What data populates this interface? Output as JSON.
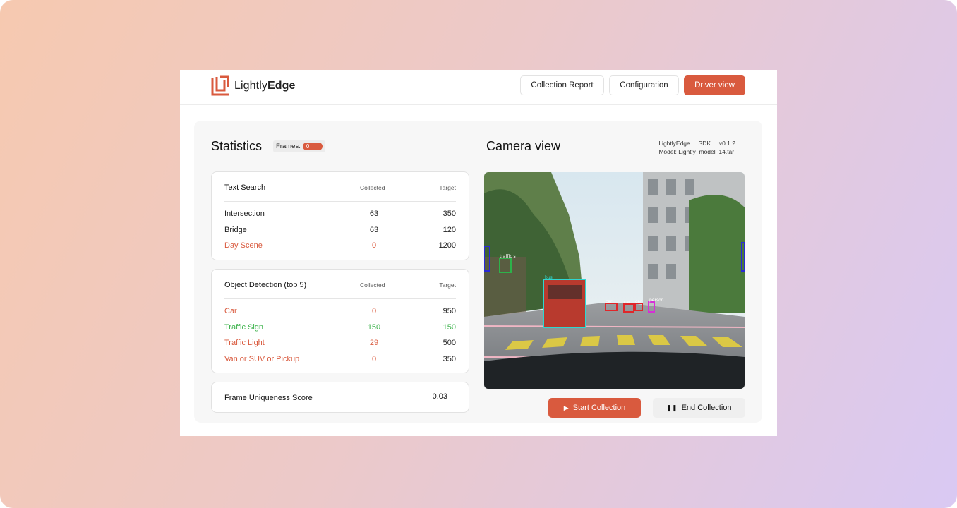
{
  "brand": {
    "prefix": "Lightly",
    "suffix": "Edge",
    "accent": "#d95a3e"
  },
  "nav": {
    "collection_report": "Collection Report",
    "configuration": "Configuration",
    "driver_view": "Driver view"
  },
  "stats": {
    "title": "Statistics",
    "frames_label": "Frames:",
    "frames_value": "0",
    "text_search": {
      "title": "Text Search",
      "col_collected": "Collected",
      "col_target": "Target",
      "rows": [
        {
          "label": "Intersection",
          "collected": "63",
          "target": "350"
        },
        {
          "label": "Bridge",
          "collected": "63",
          "target": "120"
        },
        {
          "label": "Day Scene",
          "collected": "0",
          "target": "1200"
        }
      ]
    },
    "object_detection": {
      "title": "Object Detection (top 5)",
      "col_collected": "Collected",
      "col_target": "Target",
      "rows": [
        {
          "label": "Car",
          "collected": "0",
          "target": "950"
        },
        {
          "label": "Traffic Sign",
          "collected": "150",
          "target": "150"
        },
        {
          "label": "Traffic Light",
          "collected": "29",
          "target": "500"
        },
        {
          "label": "Van or SUV or Pickup",
          "collected": "0",
          "target": "350"
        }
      ]
    },
    "uniqueness": {
      "label": "Frame Uniqueness Score",
      "value": "0.03"
    }
  },
  "camera": {
    "title": "Camera view",
    "sdk_line": "LightlyEdge     SDK     v0.1.2",
    "model_line": "Model: Lightly_model_14.tar",
    "detections": [
      "traffic s",
      "bus",
      "car",
      "car",
      "car",
      "person"
    ]
  },
  "actions": {
    "start": "Start Collection",
    "end": "End Collection"
  }
}
